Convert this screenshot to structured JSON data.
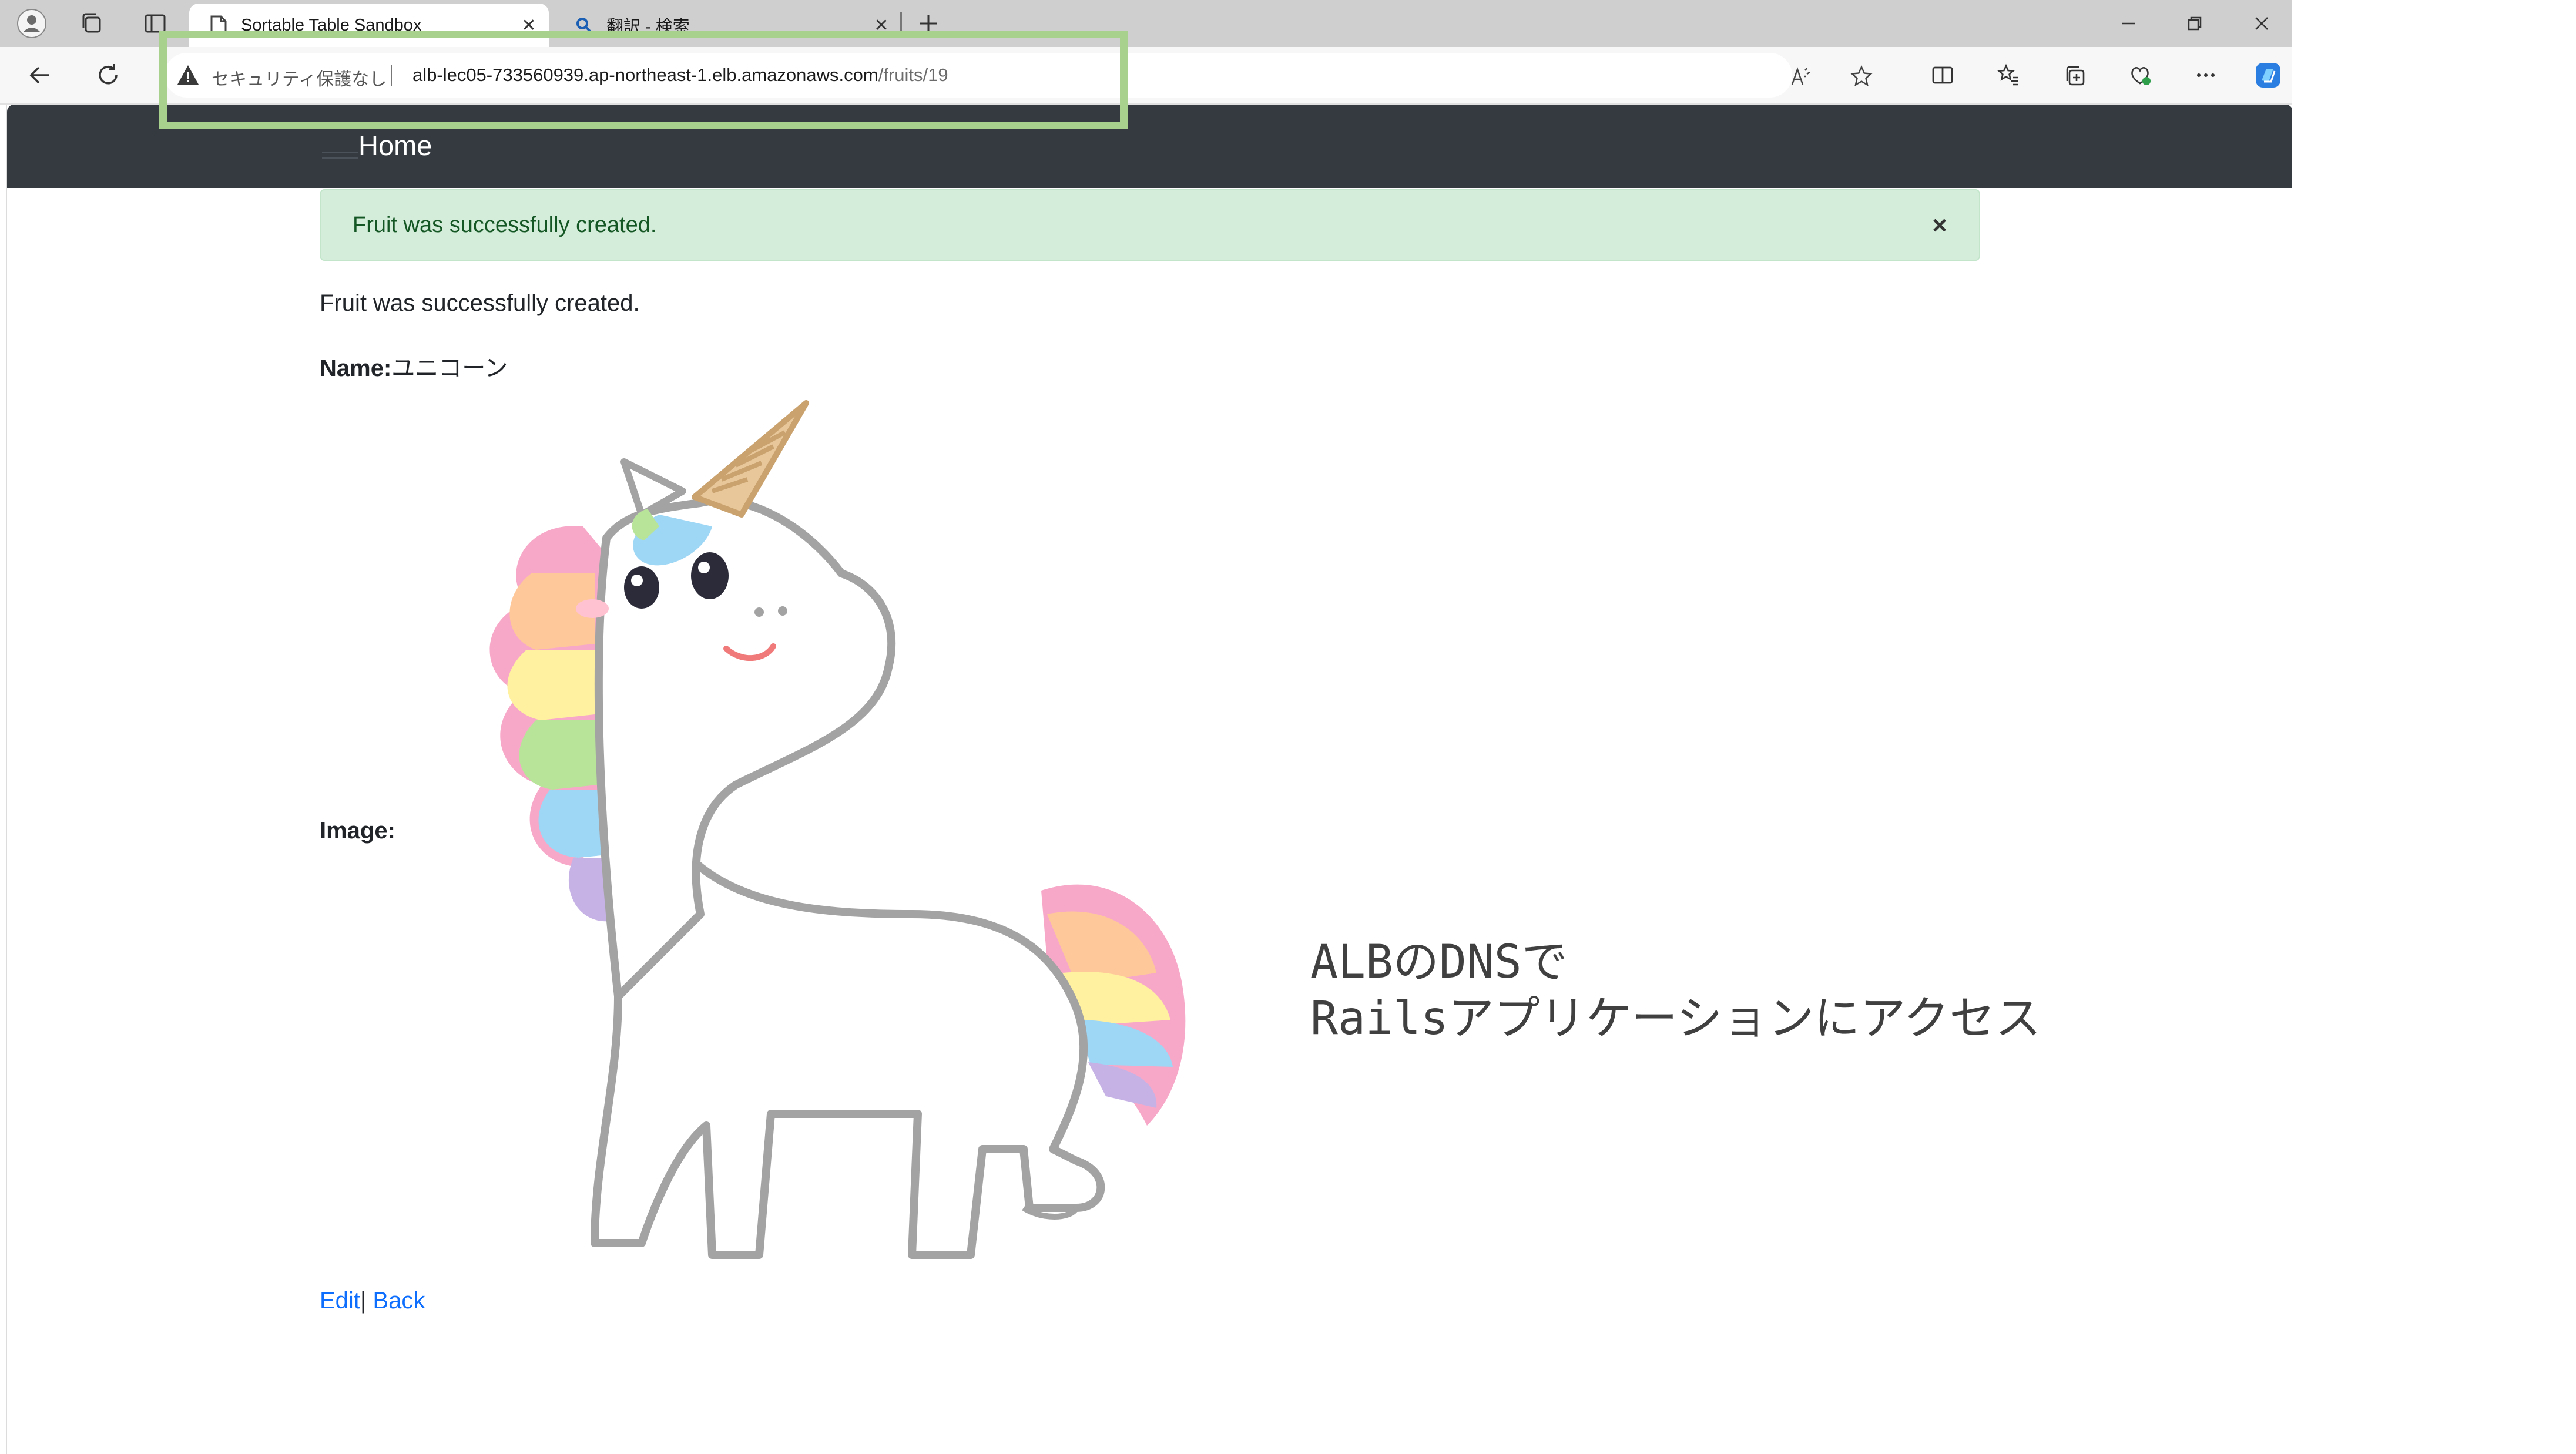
{
  "browser": {
    "tabs": [
      {
        "title": "Sortable Table Sandbox",
        "active": true,
        "favicon": "page-icon"
      },
      {
        "title": "翻訳 - 検索",
        "active": false,
        "favicon": "search-icon"
      }
    ],
    "address": {
      "security_label": "セキュリティ保護なし",
      "host": "alb-lec05-733560939.ap-northeast-1.elb.amazonaws.com",
      "path": "/fruits/19"
    },
    "read_aloud_glyph": "À"
  },
  "page": {
    "navbar": {
      "home_label": "Home"
    },
    "alert": {
      "message": "Fruit was successfully created.",
      "close_glyph": "×"
    },
    "notice": "Fruit was successfully created.",
    "name_label": "Name:",
    "name_value": "ユニコーン",
    "image_label": "Image:",
    "image_subject": "unicorn-illustration",
    "links": {
      "edit": "Edit",
      "separator": "|",
      "back": "Back"
    }
  },
  "annotation": {
    "caption_line1": "ALBのDNSで",
    "caption_line2": "Railsアプリケーションにアクセス",
    "highlight_color": "#a9d18e"
  },
  "colors": {
    "navbar_bg": "#343a40",
    "alert_bg": "#d4edda",
    "alert_text": "#155724",
    "link": "#0d6efd"
  }
}
